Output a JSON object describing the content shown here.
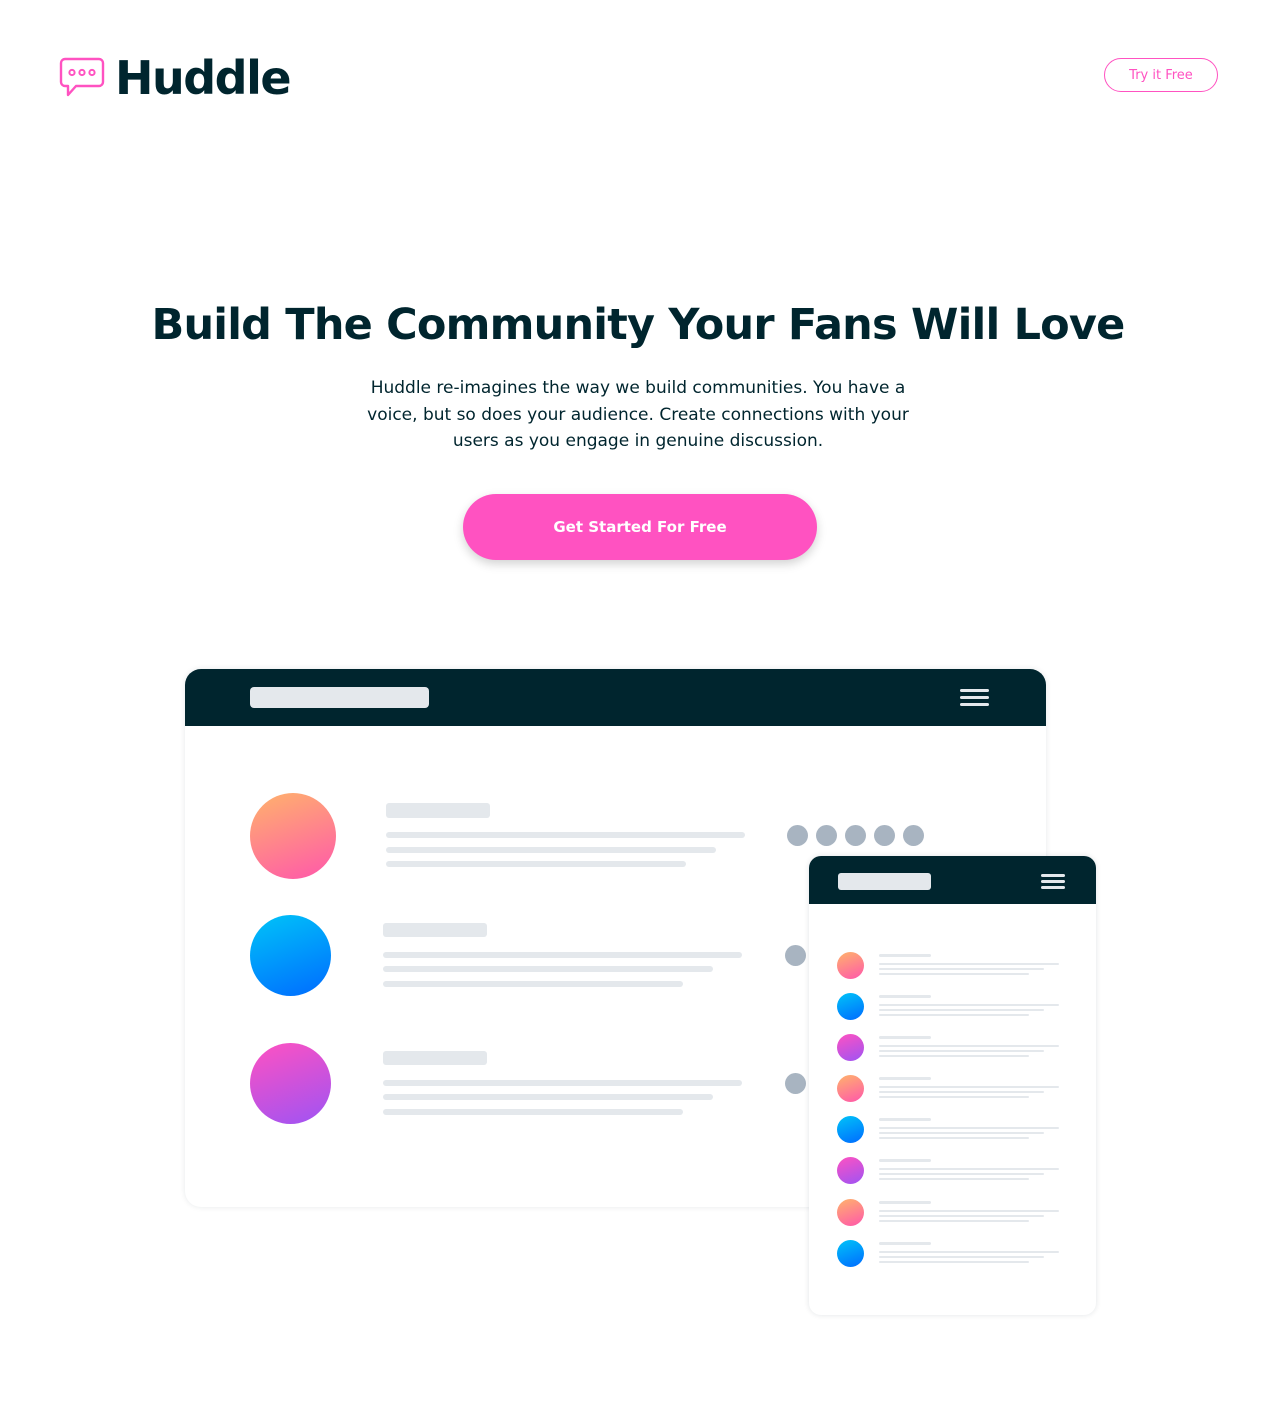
{
  "header": {
    "brand": "Huddle",
    "logo_icon": "chat-bubble-icon",
    "try_button_label": "Try it Free"
  },
  "hero": {
    "title": "Build The Community Your Fans Will Love",
    "description": "Huddle re-imagines the way we build communities. You have a voice, but so does your audience. Create connections with your users as you engage in genuine discussion.",
    "cta_label": "Get Started For Free"
  },
  "illustration": {
    "menu_icon": "hamburger-menu-icon",
    "desktop_posts": [
      "avatar-orange",
      "avatar-blue",
      "avatar-purple"
    ],
    "mobile_posts": [
      "avatar-orange",
      "avatar-blue",
      "avatar-purple",
      "avatar-orange",
      "avatar-blue",
      "avatar-purple",
      "avatar-orange",
      "avatar-blue"
    ]
  },
  "colors": {
    "brand_dark": "#00252e",
    "accent_pink": "#ff52c1",
    "skeleton": "#e4e8ec",
    "dot_gray": "#a8b4c1",
    "gradient_orange": [
      "#ffb36b",
      "#ff57ab"
    ],
    "gradient_blue": [
      "#00c4f8",
      "#006bff"
    ],
    "gradient_purple": [
      "#ff52c1",
      "#9e53f4"
    ]
  }
}
